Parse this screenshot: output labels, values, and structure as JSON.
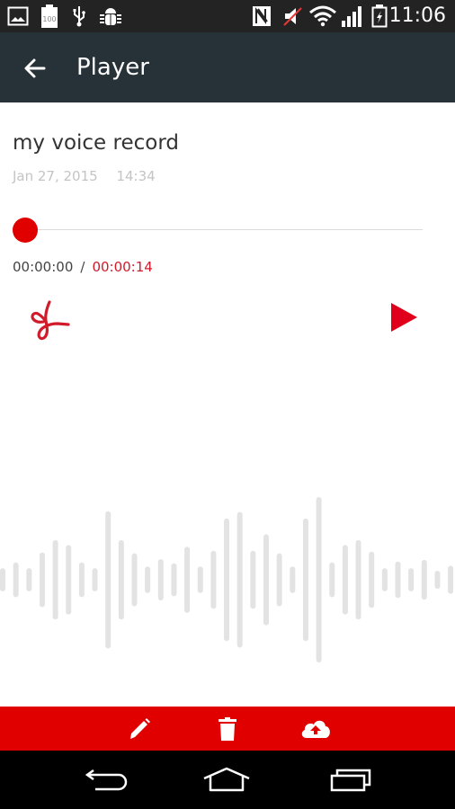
{
  "status_bar": {
    "left_icons": [
      "gallery-icon",
      "battery-100-icon",
      "usb-icon",
      "android-debug-icon"
    ],
    "battery_label": "100",
    "right_icons": [
      "nfc-icon",
      "mute-icon",
      "wifi-icon",
      "signal-icon",
      "battery-charging-icon"
    ],
    "time": "11:06"
  },
  "app_bar": {
    "back_icon": "arrow-left-icon",
    "title": "Player"
  },
  "recording": {
    "title": "my voice record",
    "date": "Jan 27, 2015",
    "time": "14:34"
  },
  "player": {
    "progress": 0.0,
    "current_time": "00:00:00",
    "separator": "/",
    "total_time": "00:00:14",
    "cut_icon": "scissors-icon",
    "play_icon": "play-icon"
  },
  "waveform": {
    "amplitudes": [
      0.14,
      0.21,
      0.14,
      0.33,
      0.48,
      0.42,
      0.21,
      0.14,
      0.83,
      0.48,
      0.32,
      0.16,
      0.25,
      0.2,
      0.4,
      0.16,
      0.35,
      0.74,
      0.82,
      0.35,
      0.55,
      0.32,
      0.16,
      0.74,
      1.0,
      0.21,
      0.42,
      0.48,
      0.34,
      0.14,
      0.22,
      0.14,
      0.24,
      0.1,
      0.17
    ]
  },
  "bottom_actions": [
    {
      "icon": "pencil-icon",
      "action": "edit"
    },
    {
      "icon": "trash-icon",
      "action": "delete"
    },
    {
      "icon": "cloud-upload-icon",
      "action": "upload"
    }
  ],
  "nav_bar": {
    "items": [
      "back-icon",
      "home-icon",
      "recents-icon"
    ]
  },
  "colors": {
    "accent": "#e00000",
    "app_bar": "#263238",
    "time_total": "#d11a2a",
    "waveform": "#e3e3e3"
  }
}
